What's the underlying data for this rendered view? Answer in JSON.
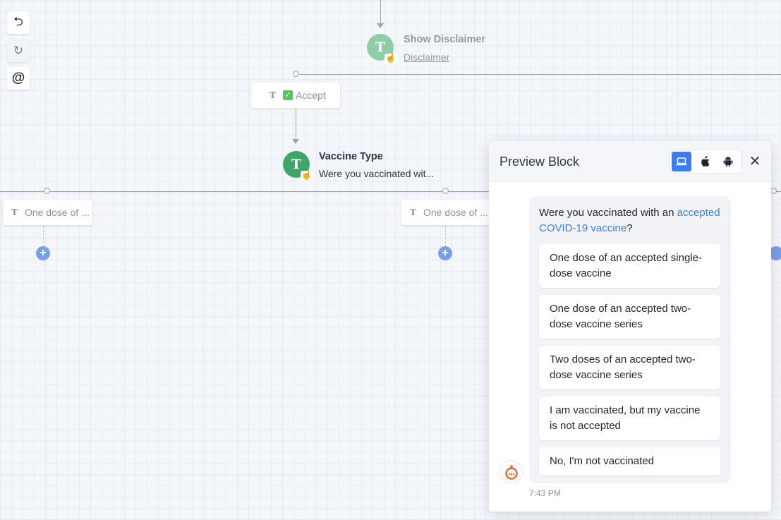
{
  "toolbar": {
    "undo_icon": "undo-icon",
    "redo_icon": "redo-icon",
    "mention_icon": "at-icon",
    "undo_glyph": "⮌",
    "redo_glyph": "↻",
    "mention_glyph": "@"
  },
  "canvas": {
    "show_disclaimer": {
      "icon_letter": "T",
      "title": "Show Disclaimer",
      "subtitle": "Disclaimer"
    },
    "accept_chip": {
      "type_letter": "T",
      "check_glyph": "✓",
      "label": "Accept"
    },
    "vaccine_type": {
      "icon_letter": "T",
      "title": "Vaccine Type",
      "subtitle": "Were you vaccinated wit..."
    },
    "option_chips": [
      {
        "type_letter": "T",
        "label": "One dose of ..."
      },
      {
        "type_letter": "T",
        "label": "One dose of ..."
      }
    ],
    "plus_glyph": "+",
    "hand_glyph": "☝"
  },
  "preview": {
    "title": "Preview Block",
    "devices": [
      {
        "name": "desktop",
        "glyph": "▭",
        "active": true
      },
      {
        "name": "apple",
        "glyph": "",
        "active": false
      },
      {
        "name": "android",
        "glyph": "▣",
        "active": false
      }
    ],
    "close_glyph": "✕",
    "message": {
      "prefix": "Were you vaccinated with an ",
      "link": "accepted COVID-19 vaccine",
      "suffix": "?"
    },
    "replies": [
      "One dose of an accepted single-dose vaccine",
      "One dose of an accepted two-dose vaccine series",
      "Two doses of an accepted two-dose vaccine series",
      "I am vaccinated, but my vaccine is not accepted",
      "No, I'm not vaccinated"
    ],
    "timestamp": "7:43 PM"
  },
  "colors": {
    "node_green": "#3fa66a",
    "accent_blue": "#3a7df0",
    "plus_blue": "#7b9ee8"
  }
}
